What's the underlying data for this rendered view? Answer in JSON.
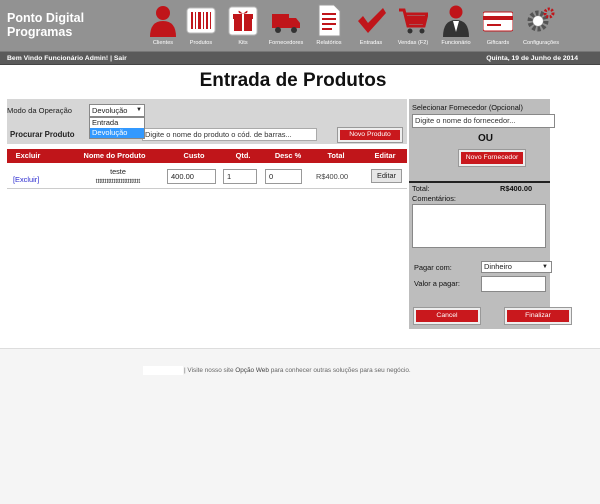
{
  "app": {
    "name_line1": "Ponto Digital",
    "name_line2": "Programas"
  },
  "nav": [
    {
      "label": "Clientes",
      "icon": "user-icon"
    },
    {
      "label": "Produtos",
      "icon": "barcode-icon"
    },
    {
      "label": "Kits",
      "icon": "gift-icon"
    },
    {
      "label": "Fornecedores",
      "icon": "truck-icon"
    },
    {
      "label": "Relatórios",
      "icon": "report-icon"
    },
    {
      "label": "Entradas",
      "icon": "checkmark-icon"
    },
    {
      "label": "Vendas (F2)",
      "icon": "cart-icon"
    },
    {
      "label": "Funcionário",
      "icon": "employee-icon"
    },
    {
      "label": "Giftcards",
      "icon": "card-icon"
    },
    {
      "label": "Configurações",
      "icon": "gear-icon"
    }
  ],
  "bar": {
    "welcome": "Bem Vindo Funcionário Admin! | Sair",
    "date": "Quinta, 19 de Junho de 2014"
  },
  "page_title": "Entrada de Produtos",
  "operation": {
    "label": "Modo da Operação",
    "selected": "Devolução",
    "options": [
      "Entrada",
      "Devolução"
    ]
  },
  "search": {
    "label": "Procurar Produto",
    "placeholder": "Digite o nome do produto o cód. de barras...",
    "new_product_button": "Novo Produto"
  },
  "table": {
    "headers": [
      "Excluir",
      "Nome do Produto",
      "Custo",
      "Qtd.",
      "Desc %",
      "Total",
      "Editar"
    ],
    "rows": [
      {
        "delete_link": "[Excluir]",
        "name": "teste",
        "name_sub": "ttttttttttttttttttttttttt",
        "cost": "400.00",
        "qty": "1",
        "disc": "0",
        "total": "R$400.00",
        "edit_button": "Editar"
      }
    ]
  },
  "supplier": {
    "label": "Selecionar Fornecedor (Opcional)",
    "input_value": "Digite o nome do fornecedor...",
    "or_text": "OU",
    "new_supplier_button": "Novo Fornecedor"
  },
  "summary": {
    "total_label": "Total:",
    "total_value": "R$400.00",
    "comments_label": "Comentários:",
    "pay_label": "Pagar com:",
    "pay_selected": "Dinheiro",
    "value_label": "Valor a pagar:",
    "value_input": ""
  },
  "actions": {
    "cancel": "Cancel",
    "finalize": "Finalizar"
  },
  "footer": {
    "text_pre": "| Visite nosso site ",
    "link": "Opção Web",
    "text_post": " para conhecer outras soluções para seu negócio."
  },
  "colors": {
    "accent": "#c0151a",
    "header": "#929292",
    "bar": "#5a5a5a"
  }
}
